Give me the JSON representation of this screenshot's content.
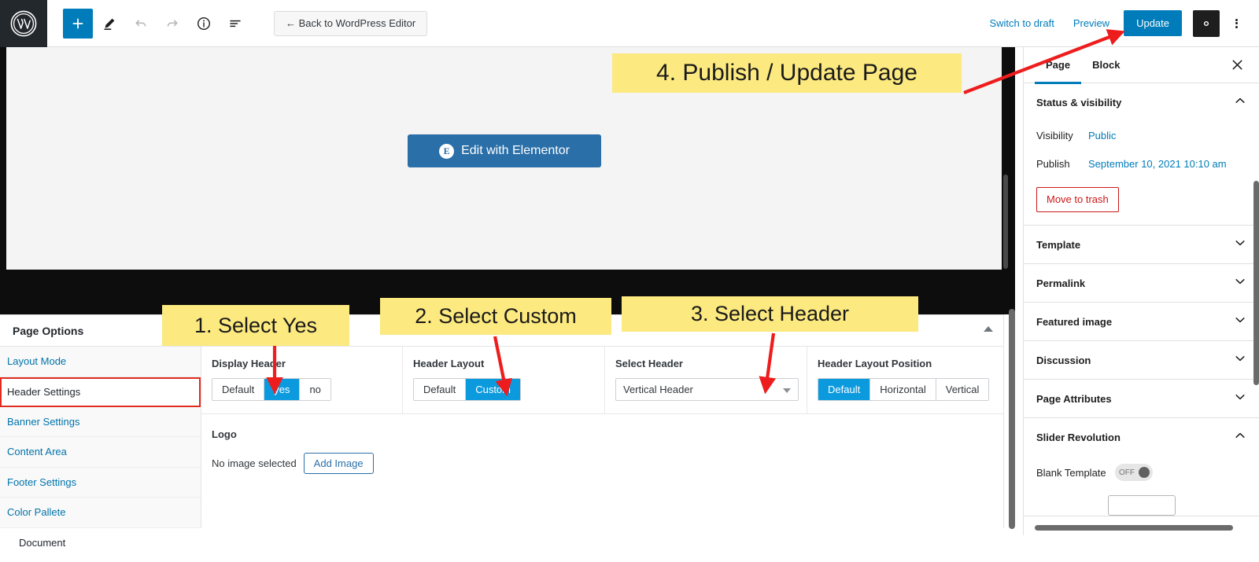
{
  "toolbar": {
    "logo_icon": "wordpress-logo-icon",
    "buttons": [
      {
        "name": "add-block-button",
        "icon": "plus-icon",
        "label": "+"
      },
      {
        "name": "edit-tool-button",
        "icon": "pencil-icon",
        "label": ""
      },
      {
        "name": "undo-button",
        "icon": "undo-icon",
        "label": ""
      },
      {
        "name": "redo-button",
        "icon": "redo-icon",
        "label": ""
      },
      {
        "name": "details-button",
        "icon": "info-icon",
        "label": ""
      },
      {
        "name": "list-view-button",
        "icon": "list-view-icon",
        "label": ""
      }
    ],
    "back_label": "← Back to WordPress Editor",
    "switch_to_draft": "Switch to draft",
    "preview": "Preview",
    "update": "Update",
    "settings_icon": "gear-icon",
    "more_icon": "kebab-menu-icon",
    "accent": "#007cba"
  },
  "canvas": {
    "elementor_button": "Edit with Elementor",
    "elementor_badge": "E"
  },
  "page_options": {
    "title": "Page Options",
    "nav": [
      {
        "label": "Layout Mode",
        "active": false
      },
      {
        "label": "Header Settings",
        "active": true
      },
      {
        "label": "Banner Settings",
        "active": false
      },
      {
        "label": "Content Area",
        "active": false
      },
      {
        "label": "Footer Settings",
        "active": false
      },
      {
        "label": "Color Pallete",
        "active": false
      }
    ],
    "fields": {
      "display_header": {
        "label": "Display Header",
        "options": [
          "Default",
          "yes",
          "no"
        ],
        "selected": "yes"
      },
      "header_layout": {
        "label": "Header Layout",
        "options": [
          "Default",
          "Custom"
        ],
        "selected": "Custom"
      },
      "select_header": {
        "label": "Select Header",
        "value": "Vertical Header"
      },
      "header_layout_position": {
        "label": "Header Layout Position",
        "options": [
          "Default",
          "Horizontal",
          "Vertical"
        ],
        "selected": "Default"
      }
    },
    "logo": {
      "label": "Logo",
      "status": "No image selected",
      "add_button": "Add Image"
    },
    "document_label": "Document"
  },
  "sidebar": {
    "tabs": [
      {
        "label": "Page",
        "active": true
      },
      {
        "label": "Block",
        "active": false
      }
    ],
    "close_icon": "close-icon",
    "panels": [
      {
        "title": "Status & visibility",
        "expanded": true
      },
      {
        "title": "Template",
        "expanded": false
      },
      {
        "title": "Permalink",
        "expanded": false
      },
      {
        "title": "Featured image",
        "expanded": false
      },
      {
        "title": "Discussion",
        "expanded": false
      },
      {
        "title": "Page Attributes",
        "expanded": false
      },
      {
        "title": "Slider Revolution",
        "expanded": true
      }
    ],
    "status": {
      "visibility_label": "Visibility",
      "visibility_value": "Public",
      "publish_label": "Publish",
      "publish_value": "September 10, 2021 10:10 am",
      "trash_label": "Move to trash",
      "trash_color": "#cc1818"
    },
    "slider_revolution": {
      "blank_template_label": "Blank Template",
      "toggle_state": "OFF"
    }
  },
  "annotations": {
    "step1": "1. Select Yes",
    "step2": "2. Select Custom",
    "step3": "3. Select Header",
    "step4": "4. Publish / Update Page",
    "highlight_color": "#fce97f",
    "arrow_color": "#ee1d1d"
  }
}
